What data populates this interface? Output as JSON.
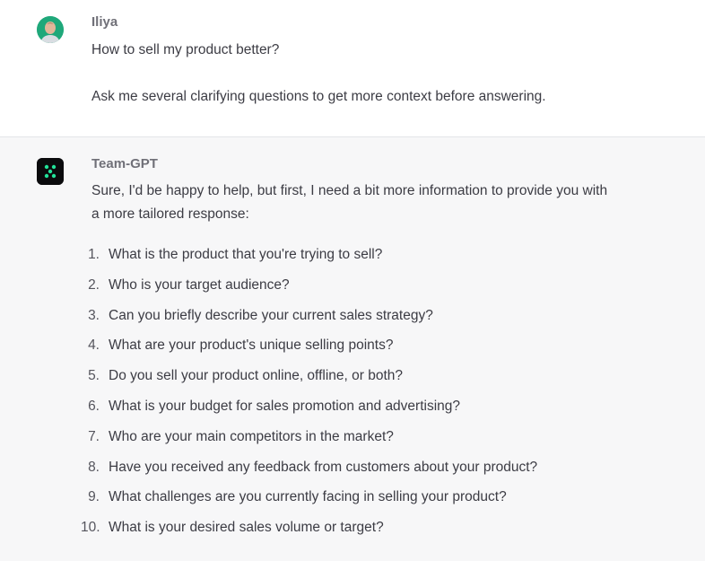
{
  "user_message": {
    "author": "Iliya",
    "avatar_icon": "user-avatar-icon",
    "lines": [
      "How to sell my product better?",
      "Ask me several clarifying questions to get more context before answering."
    ]
  },
  "bot_message": {
    "author": "Team-GPT",
    "avatar_icon": "team-gpt-logo-icon",
    "intro_lines": [
      "Sure, I'd be happy to help, but first, I need a bit more information to provide you with",
      "a more tailored response:"
    ],
    "questions": [
      {
        "num": "1.",
        "text": "What is the product that you're trying to sell?"
      },
      {
        "num": "2.",
        "text": "Who is your target audience?"
      },
      {
        "num": "3.",
        "text": "Can you briefly describe your current sales strategy?"
      },
      {
        "num": "4.",
        "text": "What are your product's unique selling points?"
      },
      {
        "num": "5.",
        "text": "Do you sell your product online, offline, or both?"
      },
      {
        "num": "6.",
        "text": "What is your budget for sales promotion and advertising?"
      },
      {
        "num": "7.",
        "text": "Who are your main competitors in the market?"
      },
      {
        "num": "8.",
        "text": "Have you received any feedback from customers about your product?"
      },
      {
        "num": "9.",
        "text": "What challenges are you currently facing in selling your product?"
      },
      {
        "num": "10.",
        "text": "What is your desired sales volume or target?"
      }
    ]
  },
  "colors": {
    "bot_background": "#f7f7f8",
    "user_avatar_bg": "#1fa87a",
    "bot_logo_accent": "#22e39a"
  }
}
